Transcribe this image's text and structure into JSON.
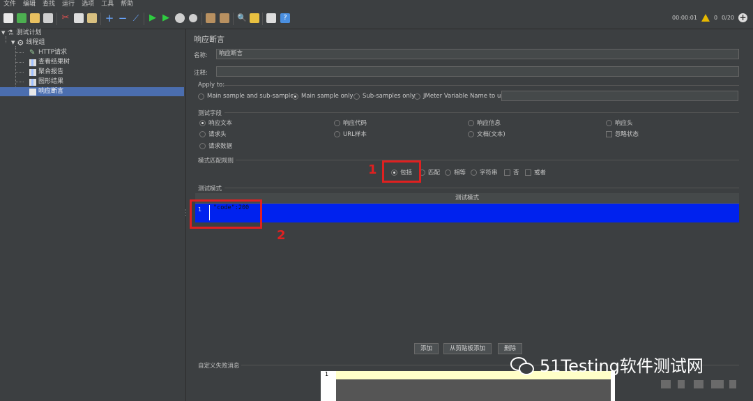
{
  "menu": [
    "文件",
    "编辑",
    "查找",
    "运行",
    "选项",
    "工具",
    "帮助"
  ],
  "status": {
    "timer": "00:00:01",
    "warnings": "0",
    "threads": "0/20"
  },
  "tree": {
    "items": [
      {
        "label": "测试计划",
        "icon": "test-plan-icon"
      },
      {
        "label": "线程组",
        "icon": "gear-icon"
      },
      {
        "label": "HTTP请求",
        "icon": "pencil-icon"
      },
      {
        "label": "查看结果树",
        "icon": "chart-icon"
      },
      {
        "label": "聚合报告",
        "icon": "chart-icon"
      },
      {
        "label": "图形结果",
        "icon": "chart-icon"
      },
      {
        "label": "响应断言",
        "icon": "assertion-icon"
      }
    ]
  },
  "panel": {
    "title": "响应断言",
    "name_label": "名称:",
    "name_value": "响应断言",
    "comment_label": "注释:",
    "comment_value": "",
    "apply_to": {
      "label": "Apply to:",
      "options": [
        "Main sample and sub-samples",
        "Main sample only",
        "Sub-samples only",
        "JMeter Variable Name to use"
      ],
      "selected": "Main sample only",
      "variable_value": ""
    },
    "test_field": {
      "label": "测试字段",
      "options": [
        "响应文本",
        "响应代码",
        "响应信息",
        "响应头",
        "请求头",
        "URL样本",
        "文档(文本)",
        "忽略状态",
        "请求数据"
      ],
      "selected": "响应文本"
    },
    "pattern_rule": {
      "label": "模式匹配规则",
      "options": [
        "包括",
        "匹配",
        "相等",
        "字符串",
        "否",
        "或者"
      ],
      "selected": "包括"
    },
    "test_pattern": {
      "label": "测试模式",
      "column": "测试模式",
      "rows": [
        {
          "num": "1",
          "text": "\"code\":200"
        }
      ]
    },
    "buttons": {
      "add": "添加",
      "paste": "从剪贴板添加",
      "delete": "删除"
    },
    "custom_failure": {
      "label": "自定义失败消息",
      "line": "1"
    }
  },
  "annotations": {
    "one": "1",
    "two": "2"
  },
  "watermark": "51Testing软件测试网"
}
